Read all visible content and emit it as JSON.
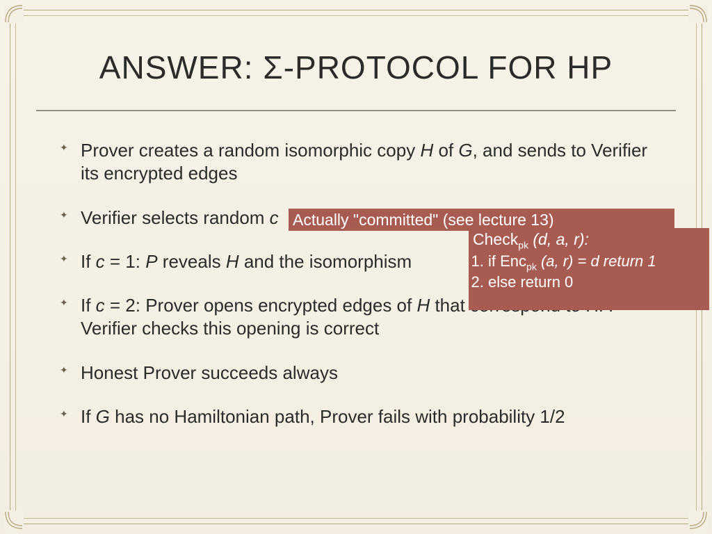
{
  "title": "ANSWER: Σ-PROTOCOL FOR HP",
  "bullets": {
    "b1_pre": "Prover creates a random isomorphic copy ",
    "b1_H": "H",
    "b1_mid": " of ",
    "b1_G": "G",
    "b1_post": ", and sends to Verifier its encrypted edges",
    "b2_pre": "Verifier selects random ",
    "b2_c": "c",
    "b3_pre": "If ",
    "b3_c": "c",
    "b3_eq": " = 1: ",
    "b3_P": "P",
    "b3_mid": " reveals ",
    "b3_H": "H",
    "b3_post": " and the isomorphism",
    "b4_pre": "If ",
    "b4_c": "c",
    "b4_eq": " = 2: Prover opens encrypted edges of ",
    "b4_H": "H",
    "b4_post": " that correspond to HP. Verifier checks this opening is correct",
    "b5": "Honest Prover succeeds always",
    "b6_pre": "If ",
    "b6_G": "G",
    "b6_post": " has no Hamiltonian path, Prover fails with probability 1/2"
  },
  "callout1": "Actually \"committed\" (see lecture 13)",
  "callout2": {
    "head_pre": "Check",
    "head_sub": "pk",
    "head_args": " (d, a, r):",
    "li1_pre": "if Enc",
    "li1_sub": "pk",
    "li1_mid": " (a, r) = d return 1",
    "li2": "else return 0"
  }
}
